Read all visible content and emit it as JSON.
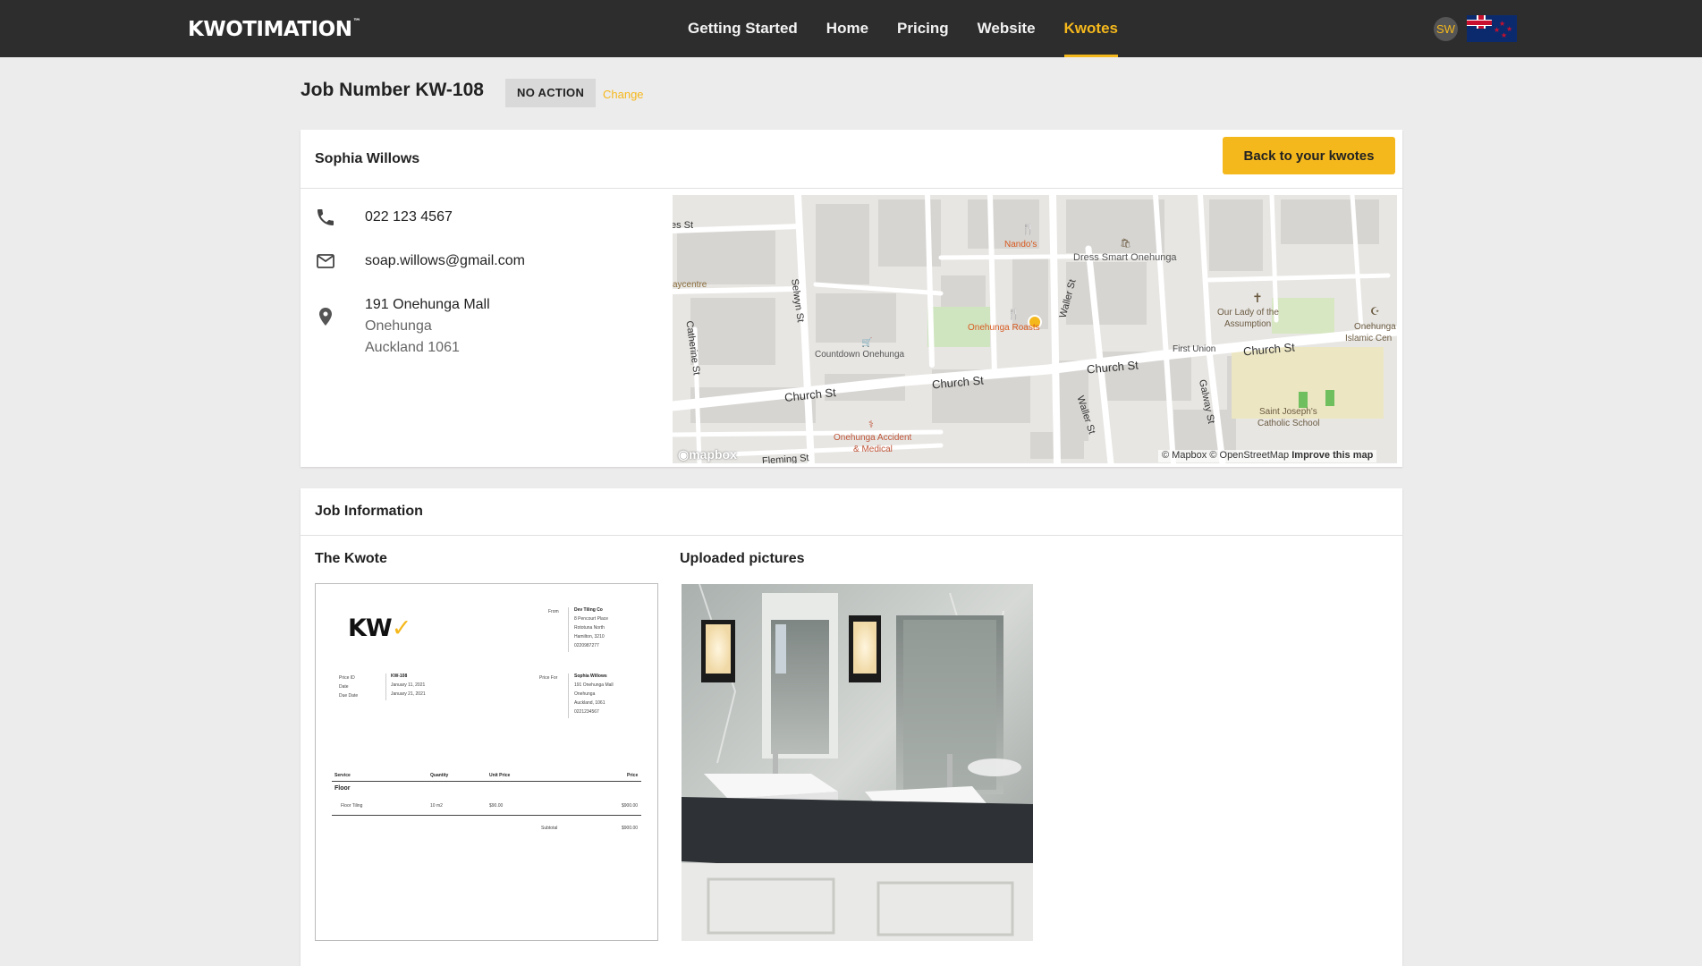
{
  "brand": {
    "logo_text": "KWOTIMATION",
    "tm": "™"
  },
  "nav": {
    "items": [
      {
        "label": "Getting Started",
        "active": false
      },
      {
        "label": "Home",
        "active": false
      },
      {
        "label": "Pricing",
        "active": false
      },
      {
        "label": "Website",
        "active": false
      },
      {
        "label": "Kwotes",
        "active": true
      }
    ]
  },
  "user": {
    "initials": "SW",
    "locale_flag": "new-zealand-flag"
  },
  "job": {
    "title": "Job Number KW-108",
    "status": "NO ACTION",
    "change_label": "Change"
  },
  "customer": {
    "name": "Sophia Willows",
    "back_button": "Back to your kwotes",
    "phone": "022 123 4567",
    "email": "soap.willows@gmail.com",
    "address_line1": "191 Onehunga Mall",
    "address_line2": "Onehunga",
    "address_line3": "Auckland 1061"
  },
  "map": {
    "labels": {
      "church_st_1": "Church St",
      "church_st_2": "Church St",
      "church_st_3": "Church St",
      "church_st_4": "Church St",
      "selwyn": "Selwyn St",
      "catherine": "Catherine St",
      "waller_1": "Waller St",
      "waller_2": "Waller St",
      "galway": "Galway St",
      "fleming": "Fleming St",
      "es": "es St",
      "aycentre": "aycentre",
      "nandos": "Nando's",
      "dress_smart": "Dress Smart Onehunga",
      "onehunga_roasts": "Onehunga Roasts",
      "countdown": "Countdown Onehunga",
      "our_lady": "Our Lady of the",
      "our_lady_2": "Assumption",
      "first_union": "First Union",
      "onehunga_islamic_1": "Onehunga",
      "onehunga_islamic_2": "Islamic Cen",
      "st_josephs_1": "Saint Joseph's",
      "st_josephs_2": "Catholic School",
      "accident_1": "Onehunga Accident",
      "accident_2": "& Medical",
      "mapbox_logo": "mapbox",
      "attribution": "© Mapbox © OpenStreetMap",
      "improve": "Improve this map"
    }
  },
  "job_info": {
    "title": "Job Information",
    "kwote_title": "The Kwote",
    "pictures_title": "Uploaded pictures"
  },
  "kwote_doc": {
    "logo": "KW",
    "from_label": "From",
    "from_name": "Dev Tiling Co",
    "from_lines": [
      "8 Pencourt Place",
      "Rototuna North",
      "Hamilton, 3210",
      "0220987277"
    ],
    "price_id_label": "Price ID",
    "price_id": "KW-108",
    "date_label": "Date",
    "date": "January 11, 2021",
    "due_label": "Due Date",
    "due": "January 21, 2021",
    "price_for_label": "Price For",
    "for_name": "Sophia Willows",
    "for_lines": [
      "191 Onehunga Mall",
      "Onehunga",
      "Auckland, 1061",
      "0221234567"
    ],
    "col_service": "Service",
    "col_quantity": "Quantity",
    "col_unit": "Unit Price",
    "col_price": "Price",
    "group": "Floor",
    "item_name": "Floor Tiling",
    "item_qty": "10 m2",
    "item_unit": "$90.00",
    "item_price": "$900.00",
    "subtotal_label": "Subtotal",
    "subtotal": "$900.00"
  }
}
